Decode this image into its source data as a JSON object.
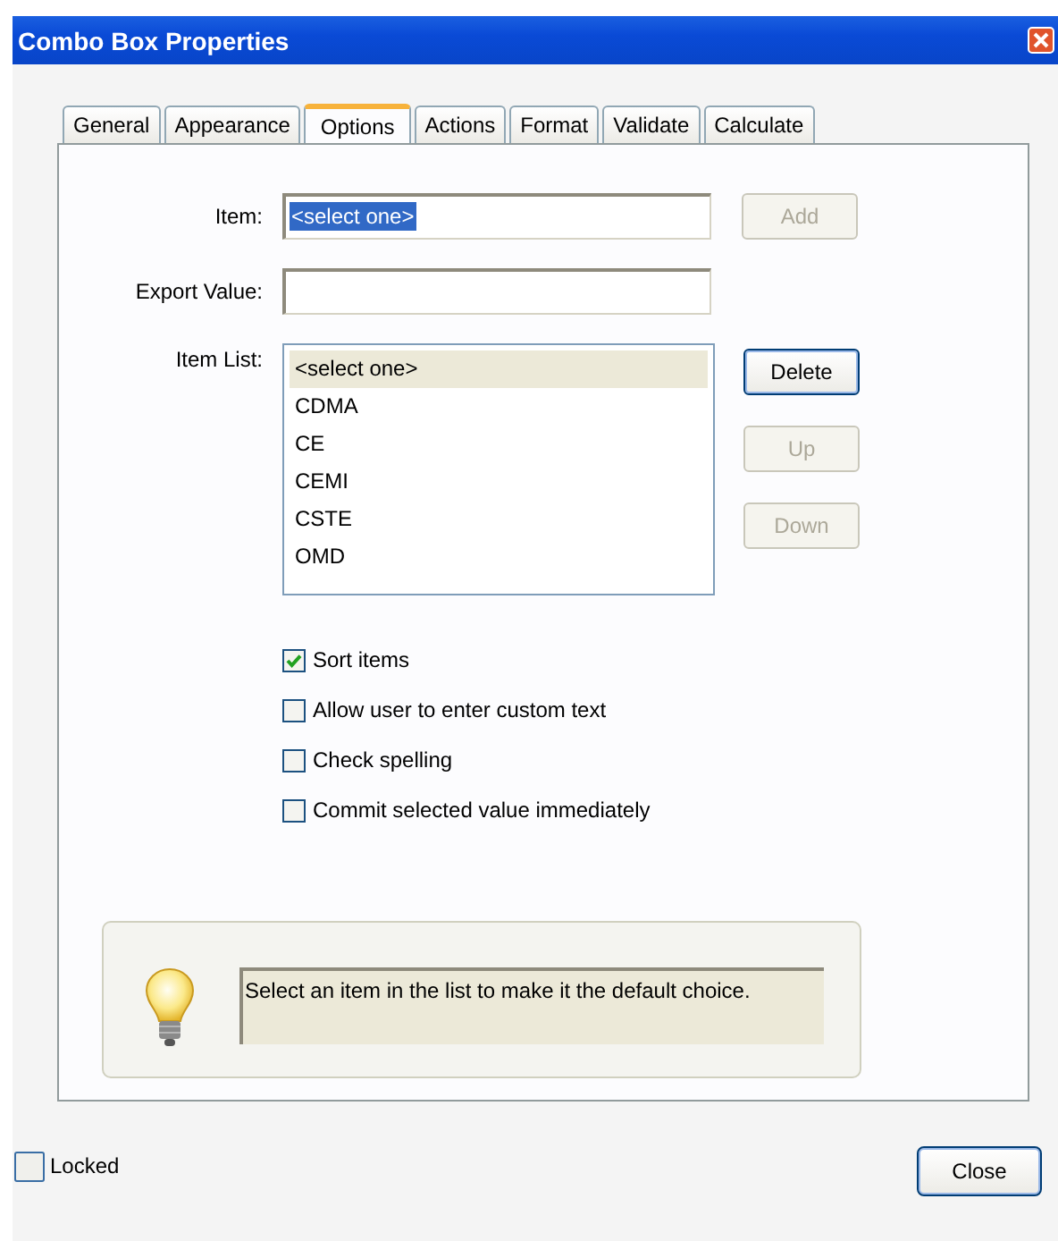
{
  "window": {
    "title": "Combo Box Properties"
  },
  "tabs": [
    {
      "label": "General",
      "selected": false
    },
    {
      "label": "Appearance",
      "selected": false
    },
    {
      "label": "Options",
      "selected": true
    },
    {
      "label": "Actions",
      "selected": false
    },
    {
      "label": "Format",
      "selected": false
    },
    {
      "label": "Validate",
      "selected": false
    },
    {
      "label": "Calculate",
      "selected": false
    }
  ],
  "item": {
    "label": "Item:",
    "value": "<select one>",
    "value_selected": true,
    "button": {
      "label": "Add",
      "disabled": true
    }
  },
  "export_value": {
    "label": "Export Value:"
  },
  "item_list": {
    "label": "Item List:",
    "items": [
      {
        "text": "<select one>",
        "selected": true
      },
      {
        "text": "CDMA",
        "selected": false
      },
      {
        "text": "CE",
        "selected": false
      },
      {
        "text": "CEMI",
        "selected": false
      },
      {
        "text": "CSTE",
        "selected": false
      },
      {
        "text": "OMD",
        "selected": false
      }
    ],
    "buttons": [
      {
        "label": "Delete",
        "disabled": false
      },
      {
        "label": "Up",
        "disabled": true
      },
      {
        "label": "Down",
        "disabled": true
      }
    ]
  },
  "options": [
    {
      "label": "Sort items",
      "checked": true
    },
    {
      "label": "Allow user to enter custom text",
      "checked": false
    },
    {
      "label": "Check spelling",
      "checked": false
    },
    {
      "label": "Commit selected value immediately",
      "checked": false
    }
  ],
  "hint": {
    "text": "Select an item in the list to make it the default choice."
  },
  "locked": {
    "label": "Locked",
    "checked": false
  },
  "close_button": {
    "label": "Close"
  }
}
